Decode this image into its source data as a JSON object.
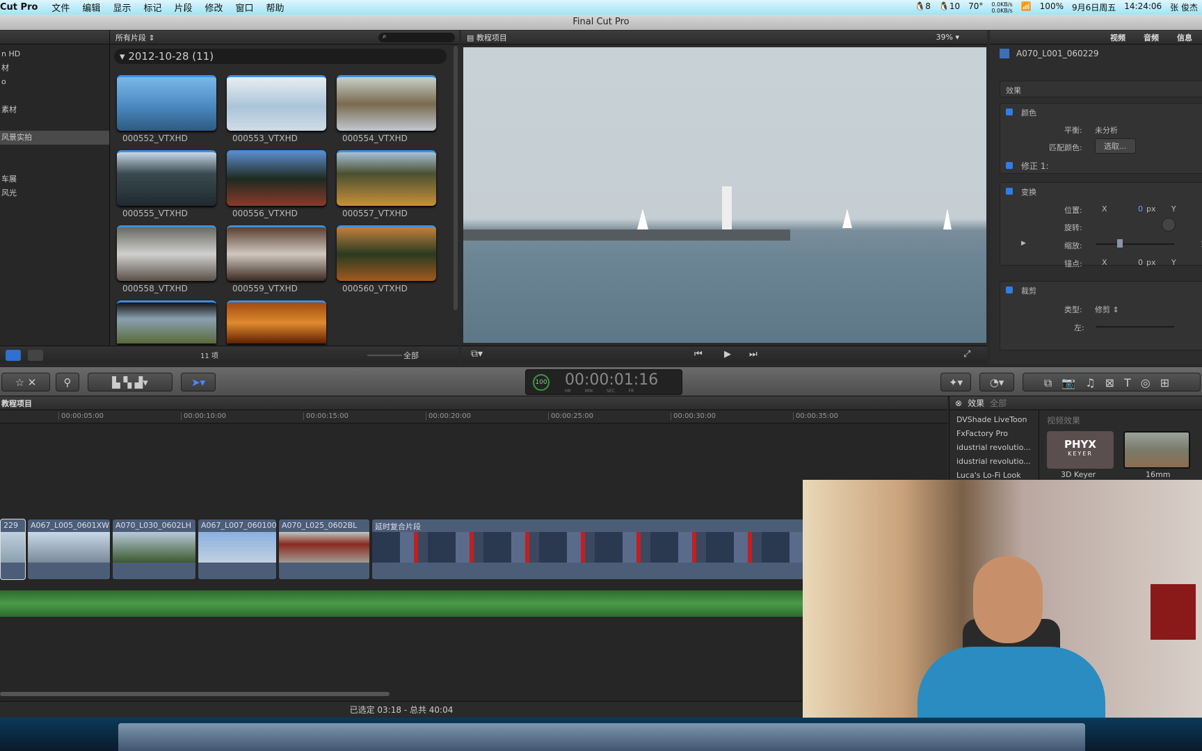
{
  "menubar": {
    "app": "Cut Pro",
    "items": [
      "文件",
      "编辑",
      "显示",
      "标记",
      "片段",
      "修改",
      "窗口",
      "帮助"
    ],
    "status": {
      "qq1": "8",
      "qq2": "10",
      "temp": "70°",
      "net_up": "0.0KB/s",
      "net_down": "0.0KB/s",
      "battery": "100%",
      "date": "9月6日周五",
      "time": "14:24:06",
      "user": "张 俊杰"
    }
  },
  "window": {
    "title": "Final Cut Pro"
  },
  "library": {
    "items": [
      "n HD",
      "材",
      "o",
      "",
      "素材",
      "",
      "风景实拍",
      "",
      "",
      "车展",
      "风光"
    ],
    "selected_index": 6
  },
  "browser": {
    "filter": "所有片段",
    "search_placeholder": "",
    "group": "2012-10-28  (11)",
    "clips": [
      "000552_VTXHD",
      "000553_VTXHD",
      "000554_VTXHD",
      "000555_VTXHD",
      "000556_VTXHD",
      "000557_VTXHD",
      "000558_VTXHD",
      "000559_VTXHD",
      "000560_VTXHD",
      "",
      ""
    ],
    "count": "11 项",
    "zoom_label": "全部"
  },
  "viewer": {
    "project": "教程项目",
    "zoom": "39%"
  },
  "inspector": {
    "tabs": [
      "视频",
      "音频",
      "信息"
    ],
    "clip": "A070_L001_060229",
    "effects": "效果",
    "color": {
      "title": "颜色",
      "balance_label": "平衡:",
      "balance_value": "未分析",
      "match_label": "匹配颜色:",
      "match_button": "选取...",
      "correction": "修正 1:"
    },
    "transform": {
      "title": "变换",
      "position_label": "位置:",
      "x": "X",
      "y": "Y",
      "pos_x": "0",
      "unit": "px",
      "rotation_label": "旋转:",
      "scale_label": "缩放:",
      "scale_value": "1",
      "anchor_label": "锚点:",
      "anchor_x": "0"
    },
    "crop": {
      "title": "裁剪",
      "type_label": "类型:",
      "type_value": "修剪",
      "left_label": "左:"
    }
  },
  "timecode": {
    "percent": "100",
    "value": "00:00:01:16",
    "units": [
      "HR",
      "MIN",
      "SEC",
      "FR"
    ]
  },
  "timeline": {
    "project": "教程项目",
    "ruler": [
      "00:00:05:00",
      "00:00:10:00",
      "00:00:15:00",
      "00:00:20:00",
      "00:00:25:00",
      "00:00:30:00",
      "00:00:35:00"
    ],
    "clips": [
      "229",
      "A067_L005_0601XW",
      "A070_L030_0602LH",
      "A067_L007_060100",
      "A070_L025_0602BL",
      "延时复合片段"
    ]
  },
  "effects": {
    "title": "效果",
    "all": "全部",
    "list": [
      "DVShade LiveToon",
      "FxFactory Pro",
      "idustrial revolutio...",
      "idustrial revolutio...",
      "Luca's Lo-Fi Look"
    ],
    "category": "视频效果",
    "items": [
      {
        "name": "3D Keyer",
        "logo": "PHYX",
        "logo_sub": "KEYER"
      },
      {
        "name": "16mm"
      }
    ]
  },
  "status": {
    "text": "已选定 03:18 - 总共 40:04"
  },
  "colors": {
    "accent": "#3d8fe0",
    "audio": "#4a9a4a",
    "clip": "#4c5d77"
  }
}
